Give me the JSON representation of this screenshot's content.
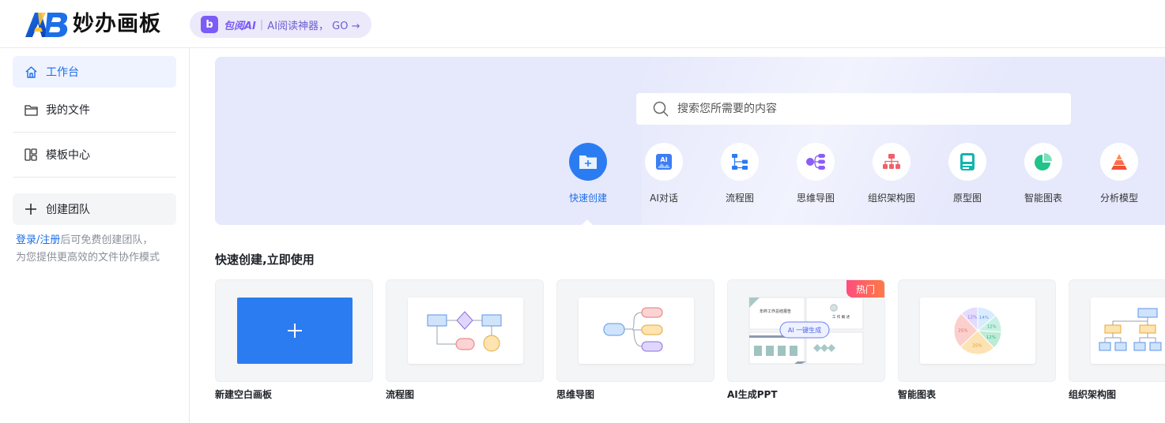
{
  "header": {
    "app_name": "妙办画板",
    "promo": {
      "icon_letter": "b",
      "brand": "包阅AI",
      "separator": "|",
      "text": "AI阅读神器， GO →"
    }
  },
  "sidebar": {
    "items": [
      {
        "label": "工作台",
        "icon": "home-icon",
        "active": true
      },
      {
        "label": "我的文件",
        "icon": "folder-icon",
        "active": false
      },
      {
        "label": "模板中心",
        "icon": "template-icon",
        "active": false
      }
    ],
    "create_team": {
      "label": "创建团队",
      "icon": "plus-icon"
    },
    "login_tip": {
      "link": "登录/注册",
      "text_1": "后可免费创建团队，",
      "text_2": "为您提供更高效的文件协作模式"
    }
  },
  "banner": {
    "search": {
      "placeholder": "搜索您所需要的内容",
      "value": ""
    },
    "tools": [
      {
        "label": "快速创建",
        "icon": "folder-plus-icon",
        "active": true
      },
      {
        "label": "AI对话",
        "icon": "ai-chat-icon",
        "active": false
      },
      {
        "label": "流程图",
        "icon": "flowchart-icon",
        "active": false
      },
      {
        "label": "思维导图",
        "icon": "mindmap-icon",
        "active": false
      },
      {
        "label": "组织架构图",
        "icon": "org-chart-icon",
        "active": false
      },
      {
        "label": "原型图",
        "icon": "prototype-icon",
        "active": false
      },
      {
        "label": "智能图表",
        "icon": "pie-chart-icon",
        "active": false
      },
      {
        "label": "分析模型",
        "icon": "pyramid-icon",
        "active": false
      }
    ]
  },
  "quick_create": {
    "title": "快速创建,立即使用",
    "cards": [
      {
        "title": "新建空白画板",
        "icon": "plus-icon"
      },
      {
        "title": "流程图"
      },
      {
        "title": "思维导图"
      },
      {
        "title": "AI生成PPT",
        "badge": "热门",
        "thumb_text": {
          "heading": "年终工作总结报告",
          "num": "01",
          "section": "工 作 概 述",
          "button": "AI 一键生成"
        }
      },
      {
        "title": "智能图表",
        "pie": [
          {
            "label": "14%",
            "value": 14
          },
          {
            "label": "12%",
            "value": 12
          },
          {
            "label": "12%",
            "value": 12
          },
          {
            "label": "25%",
            "value": 25
          },
          {
            "label": "25%",
            "value": 25
          },
          {
            "label": "12%",
            "value": 12
          }
        ]
      },
      {
        "title": "组织架构图"
      }
    ]
  },
  "colors": {
    "primary": "#2b7cf0",
    "banner_bg": "#e6e9fc",
    "promo_bg": "#ece9fb",
    "hot_badge": "#ff5a6e"
  }
}
